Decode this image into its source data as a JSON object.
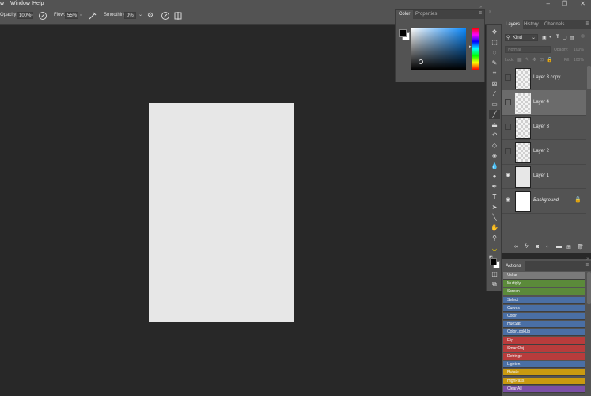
{
  "menu": {
    "items": [
      "w",
      "Window",
      "Help"
    ]
  },
  "window_controls": {
    "minimize": "–",
    "restore": "❐",
    "close": "✕"
  },
  "options_bar": {
    "opacity_label": "Opacity:",
    "opacity_value": "100%",
    "flow_label": "Flow:",
    "flow_value": "55%",
    "smoothing_label": "Smoothing:",
    "smoothing_value": "0%"
  },
  "color_panel": {
    "tabs": [
      "Color",
      "Properties"
    ],
    "accent_colors": {
      "hue_top": "#ff0000",
      "picker_base": "#0a8aff"
    }
  },
  "layers_panel": {
    "tabs": [
      "Layers",
      "History",
      "Channels"
    ],
    "filter_label": "Kind",
    "blend_mode": "Normal",
    "opacity_label": "Opacity:",
    "opacity_value": "100%",
    "lock_label": "Lock:",
    "fill_label": "Fill:",
    "fill_value": "100%",
    "layers": [
      {
        "name": "Layer 3 copy",
        "visible": false,
        "selected": false,
        "italic": false,
        "thumb": "transparent"
      },
      {
        "name": "Layer 4",
        "visible": false,
        "selected": true,
        "italic": false,
        "thumb": "transparent"
      },
      {
        "name": "Layer 3",
        "visible": false,
        "selected": false,
        "italic": false,
        "thumb": "transparent"
      },
      {
        "name": "Layer 2",
        "visible": false,
        "selected": false,
        "italic": false,
        "thumb": "transparent"
      },
      {
        "name": "Layer 1",
        "visible": true,
        "selected": false,
        "italic": false,
        "thumb": "gray"
      },
      {
        "name": "Background",
        "visible": true,
        "selected": false,
        "italic": true,
        "thumb": "white",
        "locked": true
      }
    ],
    "footer_icons": [
      "link-icon",
      "fx-icon",
      "mask-icon",
      "adjustment-icon",
      "folder-icon",
      "new-layer-icon",
      "trash-icon"
    ]
  },
  "actions_panel": {
    "title": "Actions",
    "items": [
      {
        "label": "Value",
        "color": "#7a7a7a"
      },
      {
        "label": "Multiply",
        "color": "#5b8a3a"
      },
      {
        "label": "Screen",
        "color": "#5b8a3a"
      },
      {
        "label": "Select",
        "color": "#4a6fa5"
      },
      {
        "label": "Curves",
        "color": "#4a6fa5"
      },
      {
        "label": "Color",
        "color": "#4a6fa5"
      },
      {
        "label": "HueSat",
        "color": "#4a6fa5"
      },
      {
        "label": "ColorLookUp",
        "color": "#4a6fa5"
      },
      {
        "label": "Flip",
        "color": "#b83c3c"
      },
      {
        "label": "SmartObj",
        "color": "#b83c3c"
      },
      {
        "label": "Defringe",
        "color": "#b83c3c"
      },
      {
        "label": "Lighten",
        "color": "#4a6fa5"
      },
      {
        "label": "Rotate",
        "color": "#c99a10"
      },
      {
        "label": "HighPass",
        "color": "#c99a10"
      },
      {
        "label": "Clear All",
        "color": "#7b4fa6"
      }
    ]
  },
  "tools": [
    "move-icon",
    "marquee-icon",
    "lasso-icon",
    "quick-select-icon",
    "crop-icon",
    "frame-icon",
    "eyedropper-icon",
    "healing-icon",
    "brush-icon",
    "clone-stamp-icon",
    "history-brush-icon",
    "eraser-icon",
    "paint-bucket-icon",
    "blur-icon",
    "dodge-icon",
    "pen-icon",
    "type-icon",
    "path-select-icon",
    "line-icon",
    "hand-icon",
    "zoom-icon",
    "banana-icon"
  ],
  "document": {
    "background": "#e7e7e7"
  }
}
